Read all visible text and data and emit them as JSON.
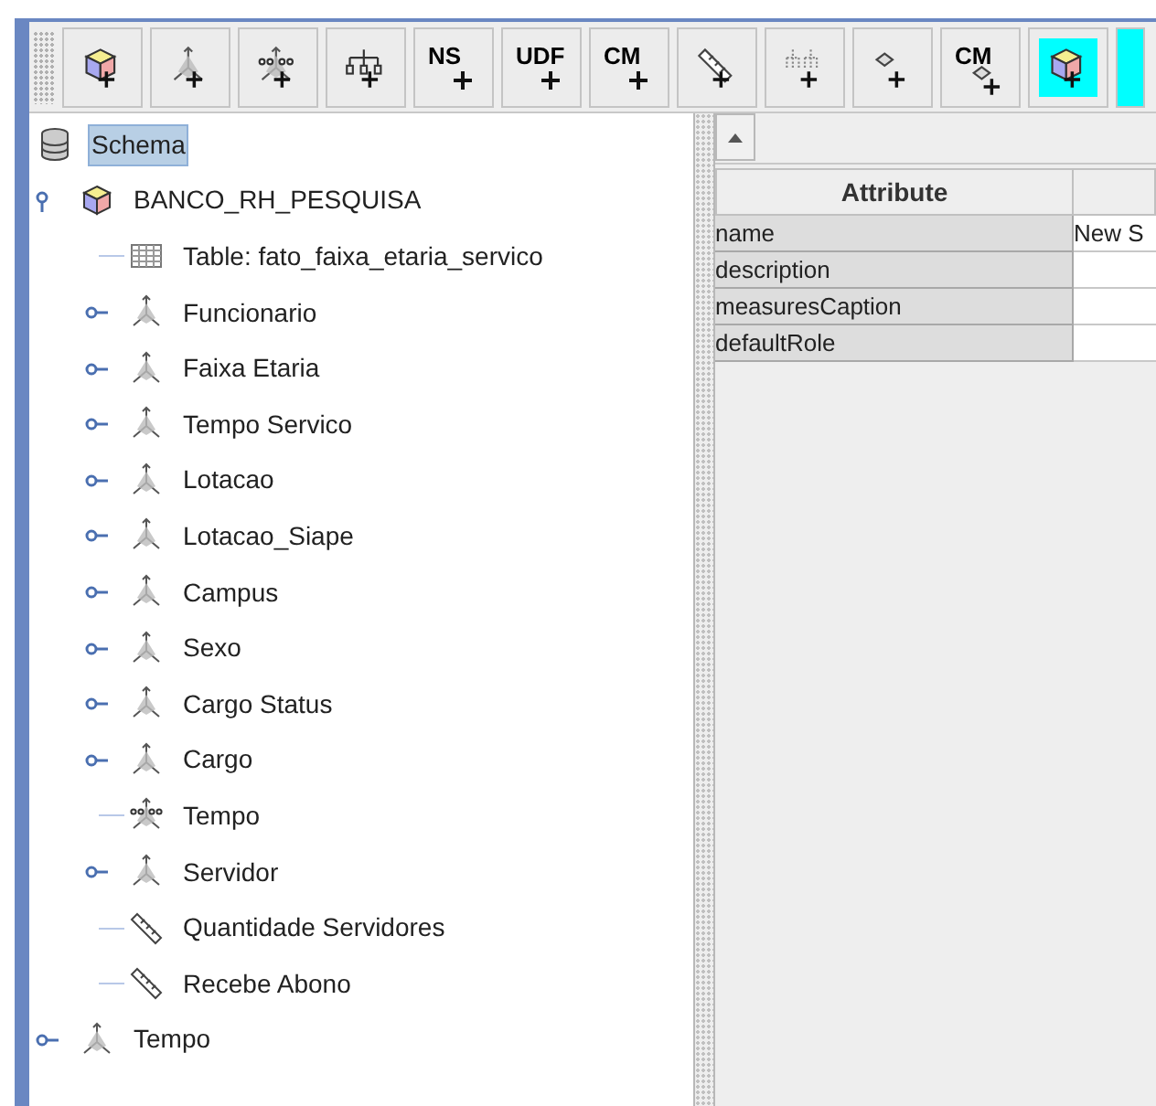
{
  "toolbar": [
    {
      "kind": "cube"
    },
    {
      "kind": "dimension"
    },
    {
      "kind": "time-dimension"
    },
    {
      "kind": "hierarchy"
    },
    {
      "kind": "text",
      "label": "NS"
    },
    {
      "kind": "text",
      "label": "UDF"
    },
    {
      "kind": "text",
      "label": "CM"
    },
    {
      "kind": "measure"
    },
    {
      "kind": "levels"
    },
    {
      "kind": "shape"
    },
    {
      "kind": "text-shape",
      "label": "CM"
    },
    {
      "kind": "cube-active"
    },
    {
      "kind": "partial"
    }
  ],
  "tree": {
    "kind": "schema",
    "label": "Schema",
    "selected": true,
    "children": [
      {
        "kind": "cube",
        "label": "BANCO_RH_PESQUISA",
        "selected": false,
        "expanded": true,
        "children": [
          {
            "kind": "table",
            "label": "Table: fato_faixa_etaria_servico",
            "selected": false
          },
          {
            "kind": "dimension",
            "label": "Funcionario",
            "selected": false,
            "expanded": false
          },
          {
            "kind": "dimension",
            "label": "Faixa Etaria",
            "selected": false,
            "expanded": false
          },
          {
            "kind": "dimension",
            "label": "Tempo Servico",
            "selected": false,
            "expanded": false
          },
          {
            "kind": "dimension",
            "label": "Lotacao",
            "selected": false,
            "expanded": false
          },
          {
            "kind": "dimension",
            "label": "Lotacao_Siape",
            "selected": false,
            "expanded": false
          },
          {
            "kind": "dimension",
            "label": "Campus",
            "selected": false,
            "expanded": false
          },
          {
            "kind": "dimension",
            "label": "Sexo",
            "selected": false,
            "expanded": false
          },
          {
            "kind": "dimension",
            "label": "Cargo Status",
            "selected": false,
            "expanded": false
          },
          {
            "kind": "dimension",
            "label": "Cargo",
            "selected": false,
            "expanded": false
          },
          {
            "kind": "time-dimension",
            "label": "Tempo",
            "selected": false
          },
          {
            "kind": "dimension",
            "label": "Servidor",
            "selected": false,
            "expanded": false
          },
          {
            "kind": "measure",
            "label": "Quantidade Servidores",
            "selected": false
          },
          {
            "kind": "measure",
            "label": "Recebe Abono",
            "selected": false
          }
        ]
      },
      {
        "kind": "dimension",
        "label": "Tempo",
        "selected": false,
        "expanded": false
      }
    ]
  },
  "table": {
    "columns": [
      "Attribute"
    ],
    "rows": [
      {
        "attribute": "name",
        "value": "New S"
      },
      {
        "attribute": "description"
      },
      {
        "attribute": "measuresCaption"
      },
      {
        "attribute": "defaultRole"
      }
    ]
  }
}
